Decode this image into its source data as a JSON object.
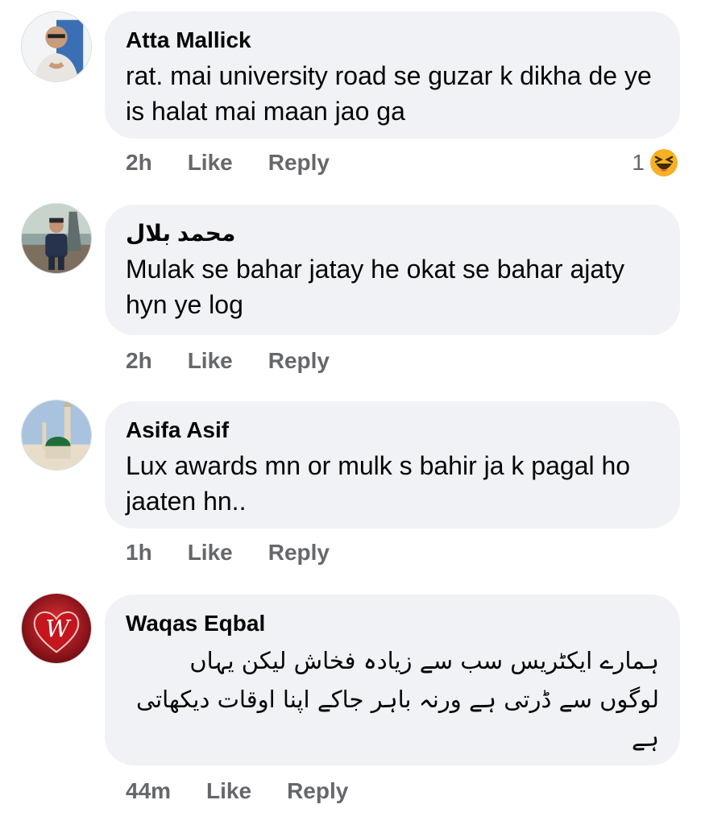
{
  "comments": [
    {
      "author": "Atta Mallick",
      "text": "rat. mai university road se guzar k dikha de ye is halat mai maan jao ga",
      "time": "2h",
      "like_label": "Like",
      "reply_label": "Reply",
      "reaction_count": "1",
      "reaction_icon": "haha-emoji-icon"
    },
    {
      "author": "محمد بلال",
      "text": "Mulak se bahar jatay he okat se bahar ajaty hyn ye log",
      "time": "2h",
      "like_label": "Like",
      "reply_label": "Reply"
    },
    {
      "author": "Asifa Asif",
      "text": "Lux awards mn or mulk s bahir ja k pagal ho jaaten hn..",
      "time": "1h",
      "like_label": "Like",
      "reply_label": "Reply"
    },
    {
      "author": "Waqas Eqbal",
      "text": "ہمارے ایکٹریس سب سے زیادہ فخاش لیکن یہاں لوگوں سے ڈرتی ہے ورنہ باہر جاکے اپنا اوقات دیکھاتی ہے",
      "time": "44m",
      "like_label": "Like",
      "reply_label": "Reply"
    }
  ],
  "colors": {
    "bubble": "#f0f2f5",
    "meta_text": "#65676b",
    "text": "#050505"
  }
}
